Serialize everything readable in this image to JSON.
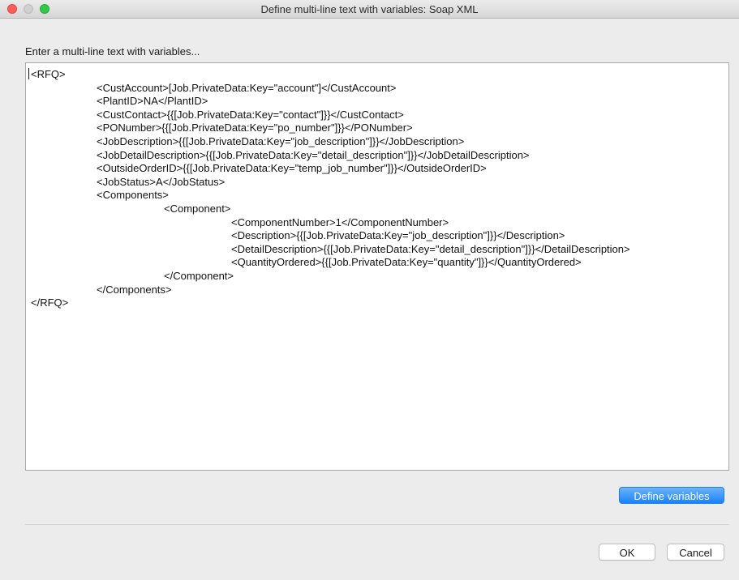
{
  "window": {
    "title": "Define multi-line text with variables: Soap XML"
  },
  "editor": {
    "prompt": "Enter a multi-line text with variables...",
    "lines": [
      {
        "indent": 0,
        "text": "<RFQ>"
      },
      {
        "indent": 1,
        "text": "<CustAccount>[Job.PrivateData:Key=\"account\"]</CustAccount>"
      },
      {
        "indent": 1,
        "text": "<PlantID>NA</PlantID>"
      },
      {
        "indent": 1,
        "text": "<CustContact>{{[Job.PrivateData:Key=\"contact\"]}}</CustContact>"
      },
      {
        "indent": 1,
        "text": "<PONumber>{{[Job.PrivateData:Key=\"po_number\"]}}</PONumber>"
      },
      {
        "indent": 1,
        "text": "<JobDescription>{{[Job.PrivateData:Key=\"job_description\"]}}</JobDescription>"
      },
      {
        "indent": 1,
        "text": "<JobDetailDescription>{{[Job.PrivateData:Key=\"detail_description\"]}}</JobDetailDescription>"
      },
      {
        "indent": 1,
        "text": "<OutsideOrderID>{{[Job.PrivateData:Key=\"temp_job_number\"]}}</OutsideOrderID>"
      },
      {
        "indent": 1,
        "text": "<JobStatus>A</JobStatus>"
      },
      {
        "indent": 1,
        "text": "<Components>"
      },
      {
        "indent": 2,
        "text": "<Component>"
      },
      {
        "indent": 3,
        "text": "<ComponentNumber>1</ComponentNumber>"
      },
      {
        "indent": 3,
        "text": "<Description>{{[Job.PrivateData:Key=\"job_description\"]}}</Description>"
      },
      {
        "indent": 3,
        "text": "<DetailDescription>{{[Job.PrivateData:Key=\"detail_description\"]}}</DetailDescription>"
      },
      {
        "indent": 3,
        "text": "<QuantityOrdered>{{[Job.PrivateData:Key=\"quantity\"]}}</QuantityOrdered>"
      },
      {
        "indent": 2,
        "text": "</Component>"
      },
      {
        "indent": 1,
        "text": "</Components>"
      },
      {
        "indent": 0,
        "text": "</RFQ>"
      }
    ]
  },
  "buttons": {
    "define_variables": "Define variables",
    "ok": "OK",
    "cancel": "Cancel"
  },
  "colors": {
    "accent": "#1a82fb",
    "close": "#fc5f57",
    "zoom": "#34c84a"
  },
  "icons": {
    "close": "close-window-icon",
    "minimize": "minimize-window-icon",
    "zoom": "zoom-window-icon"
  }
}
